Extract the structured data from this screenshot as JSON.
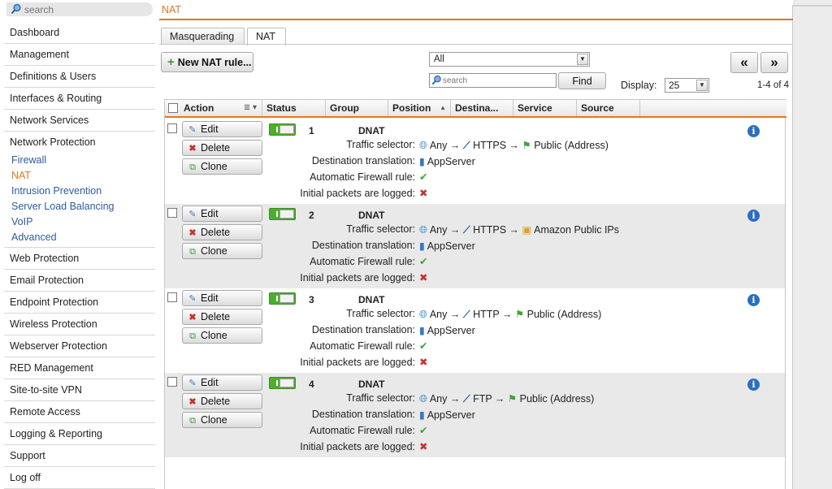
{
  "search": {
    "placeholder": "search"
  },
  "sidebar": {
    "items_top": [
      "Dashboard",
      "Management",
      "Definitions & Users",
      "Interfaces & Routing",
      "Network Services"
    ],
    "group_title": "Network Protection",
    "sub_items": [
      "Firewall",
      "NAT",
      "Intrusion Prevention",
      "Server Load Balancing",
      "VoIP",
      "Advanced"
    ],
    "current_sub": "NAT",
    "items_bottom": [
      "Web Protection",
      "Email Protection",
      "Endpoint Protection",
      "Wireless Protection",
      "Webserver Protection",
      "RED Management",
      "Site-to-site VPN",
      "Remote Access",
      "Logging & Reporting",
      "Support",
      "Log off"
    ]
  },
  "header": {
    "breadcrumb": "NAT"
  },
  "tabs": {
    "masq": "Masquerading",
    "nat": "NAT"
  },
  "toolbar": {
    "new_rule": "New NAT rule...",
    "filter_value": "All",
    "search_placeholder": "search",
    "find": "Find",
    "display_label": "Display:",
    "display_value": "25",
    "prev": "«",
    "next": "»",
    "range": "1-4 of 4"
  },
  "table": {
    "columns": [
      "Action",
      "Status",
      "Group",
      "Position",
      "Destina...",
      "Service",
      "Source"
    ],
    "labels": {
      "edit": "Edit",
      "delete": "Delete",
      "clone": "Clone",
      "traffic": "Traffic selector:",
      "dest": "Destination translation:",
      "auto": "Automatic Firewall rule:",
      "logged": "Initial packets are logged:"
    },
    "rows": [
      {
        "num": "1",
        "type": "DNAT",
        "src": "Any",
        "service": "HTTPS",
        "dest": "Public (Address)",
        "dest_kind": "flag",
        "translation": "AppServer"
      },
      {
        "num": "2",
        "type": "DNAT",
        "src": "Any",
        "service": "HTTPS",
        "dest": "Amazon Public IPs",
        "dest_kind": "group",
        "translation": "AppServer"
      },
      {
        "num": "3",
        "type": "DNAT",
        "src": "Any",
        "service": "HTTP",
        "dest": "Public (Address)",
        "dest_kind": "flag",
        "translation": "AppServer"
      },
      {
        "num": "4",
        "type": "DNAT",
        "src": "Any",
        "service": "FTP",
        "dest": "Public (Address)",
        "dest_kind": "flag",
        "translation": "AppServer"
      }
    ]
  },
  "colors": {
    "accent": "#e8761c",
    "link": "#2c5c9e",
    "toggle_on": "#4cae2f"
  }
}
